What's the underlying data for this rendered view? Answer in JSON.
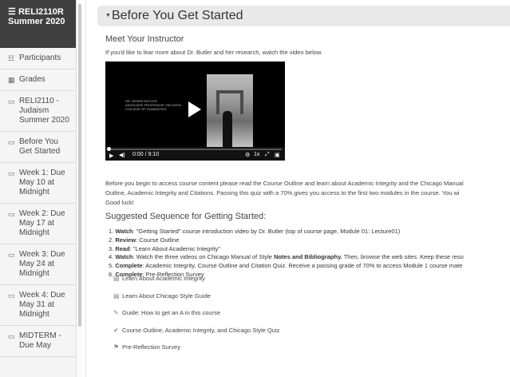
{
  "sidebar": {
    "course": "RELI2110R Summer 2020",
    "items": [
      {
        "icon": "participants-icon",
        "glyph": "☷",
        "label": "Participants"
      },
      {
        "icon": "grades-icon",
        "glyph": "▦",
        "label": "Grades"
      },
      {
        "icon": "folder-icon",
        "glyph": "▭",
        "label": "RELI2110 - Judaism Summer 2020"
      },
      {
        "icon": "folder-icon",
        "glyph": "▭",
        "label": "Before You Get Started"
      },
      {
        "icon": "folder-icon",
        "glyph": "▭",
        "label": "Week 1: Due May 10 at Midnight"
      },
      {
        "icon": "folder-icon",
        "glyph": "▭",
        "label": "Week 2: Due May 17 at Midnight"
      },
      {
        "icon": "folder-icon",
        "glyph": "▭",
        "label": "Week 3: Due May 24 at Midnight"
      },
      {
        "icon": "folder-icon",
        "glyph": "▭",
        "label": "Week 4: Due May 31 at Midnight"
      },
      {
        "icon": "folder-icon",
        "glyph": "▭",
        "label": "MIDTERM - Due May"
      }
    ]
  },
  "main": {
    "section_title": "Before You Get Started",
    "meet_heading": "Meet Your Instructor",
    "intro_text": "If you'd like to lear more about Dr. Butler and her research, watch the video below.",
    "video": {
      "caption": "DR. DESIRÉ BUTLER\nASSOCIATE PROFESSOR, RELIGION\nCOLLEGE OF HUMANITIES",
      "time": "0:00 / 9:10",
      "speed": "1x",
      "progress": 0.0
    },
    "body_lines": [
      "Before you begin to access course content please read the Course Outline and learn about Academic Integrity and the Chicago Manual",
      "Outline, Academic Integrity and Citations. Passing this quiz with a 70% gives you access to the first two modules in the course. You wi",
      "Good luck!"
    ],
    "sequence_heading": "Suggested Sequence for Getting Started:",
    "steps": [
      {
        "num": "1.",
        "bold": "Watch",
        "text": ": \"Getting Started\" course introduction video by Dr. Butler (top of course page, Module 01: Lecture01)"
      },
      {
        "num": "2.",
        "bold": "Review",
        "text": ": Course Outline"
      },
      {
        "num": "3.",
        "bold": "Read",
        "text": ": \"Learn About Academic Integrity\""
      },
      {
        "num": "4.",
        "bold": "Watch",
        "text": ": Watch the three videos on Chicago Manual of Style ",
        "bold2": "Notes and Bibliography.",
        "text2": " Then, browse the web sites. Keep these reso"
      },
      {
        "num": "5.",
        "bold": "Complete",
        "text": ":  Academic Integrity, Course Outline and Citation Quiz.  Receive a passing grade of 70% to access Module 1 course mate"
      },
      {
        "num": "6.",
        "bold": "Complete",
        "text": ": Pre-Reflection Survey"
      }
    ],
    "activities": [
      {
        "icon": "page-icon",
        "glyph": "▤",
        "label": "Learn About Academic Integrity"
      },
      {
        "icon": "page-icon",
        "glyph": "▤",
        "label": "Learn About Chicago Style Guide"
      },
      {
        "icon": "guide-icon",
        "glyph": "✎",
        "label": "Guide: How to get an A in this course"
      },
      {
        "icon": "quiz-icon",
        "glyph": "✔",
        "label": "Course Outline, Academic Integrity, and Chicago Style Quiz"
      },
      {
        "icon": "survey-icon",
        "glyph": "⚑",
        "label": "Pre-Reflection Survey"
      }
    ]
  },
  "colors": {
    "sidebar_header": "#3f3f3f",
    "section_bar": "#e9e9e9",
    "video_bg": "#000000"
  }
}
